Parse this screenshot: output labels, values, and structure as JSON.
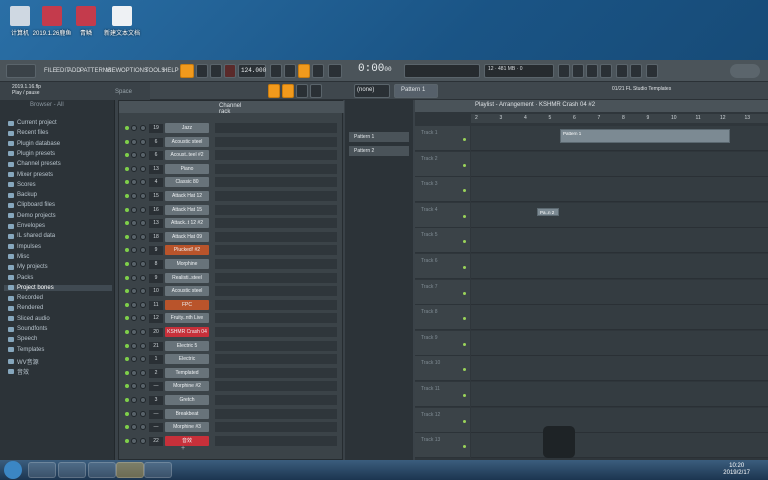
{
  "desktop": {
    "icons": [
      {
        "label": "计算机",
        "color": "#cfd8e2"
      },
      {
        "label": "2019.1.26鹿鱼",
        "color": "#c43b4c"
      },
      {
        "label": "青鳞",
        "color": "#c43b4c"
      },
      {
        "label": "新建文本文档",
        "color": "#eef1f4"
      }
    ]
  },
  "menu": {
    "items": [
      "FILE",
      "EDIT",
      "ADD",
      "PATTERNS",
      "VIEW",
      "OPTIONS",
      "TOOLS",
      "HELP"
    ]
  },
  "transport": {
    "tempo": "124.000",
    "time": "0:00",
    "time_small": "00",
    "pattern_label": "Pattern 1",
    "snap": "(none)",
    "cpu": "12",
    "mem": "481 MB",
    "voices": "0"
  },
  "hint": {
    "file": "2019.1.16.flp",
    "status": "Play / pause"
  },
  "row2": {
    "space_label": "Space",
    "all_label": "All",
    "channel_rack_label": "Channel rack",
    "project_info": "01/21 FL Studio Templates"
  },
  "browser": {
    "header": "Browser - All",
    "items": [
      "Current project",
      "Recent files",
      "Plugin database",
      "Plugin presets",
      "Channel presets",
      "Mixer presets",
      "Scores",
      "Backup",
      "Clipboard files",
      "Demo projects",
      "Envelopes",
      "IL shared data",
      "Impulses",
      "Misc",
      "My projects",
      "Packs",
      "Project bones",
      "Recorded",
      "Rendered",
      "Sliced audio",
      "Soundfonts",
      "Speech",
      "Templates",
      "WV音源",
      "音效"
    ],
    "selected_index": 16
  },
  "channels": [
    {
      "num": "19",
      "name": "Jazz",
      "style": "grey"
    },
    {
      "num": "6",
      "name": "Acoustic steel",
      "style": "grey"
    },
    {
      "num": "6",
      "name": "Acoust..teel #2",
      "style": "grey"
    },
    {
      "num": "13",
      "name": "Piano",
      "style": "grey"
    },
    {
      "num": "4",
      "name": "Classic 80",
      "style": "grey"
    },
    {
      "num": "15",
      "name": "Attack Hat 12",
      "style": "grey"
    },
    {
      "num": "16",
      "name": "Attack Hat 15",
      "style": "grey"
    },
    {
      "num": "13",
      "name": "Attack..t 12 #2",
      "style": "grey"
    },
    {
      "num": "18",
      "name": "Attack Hat 09",
      "style": "grey"
    },
    {
      "num": "9",
      "name": "Plucked! #2",
      "style": "orange"
    },
    {
      "num": "8",
      "name": "Morphine",
      "style": "grey"
    },
    {
      "num": "9",
      "name": "Realisti..steel",
      "style": "grey"
    },
    {
      "num": "10",
      "name": "Acoustic steel",
      "style": "grey"
    },
    {
      "num": "11",
      "name": "FPC",
      "style": "orange"
    },
    {
      "num": "12",
      "name": "Fruity..nth Live",
      "style": "grey"
    },
    {
      "num": "20",
      "name": "KSHMR Crash 04",
      "style": "red"
    },
    {
      "num": "21",
      "name": "Electric 5",
      "style": "grey"
    },
    {
      "num": "1",
      "name": "Electric",
      "style": "grey"
    },
    {
      "num": "2",
      "name": "Templated",
      "style": "grey"
    },
    {
      "num": "—",
      "name": "Morphine #2",
      "style": "grey"
    },
    {
      "num": "3",
      "name": "Gretch",
      "style": "grey"
    },
    {
      "num": "—",
      "name": "Breakbeat",
      "style": "grey"
    },
    {
      "num": "—",
      "name": "Morphine #3",
      "style": "grey"
    },
    {
      "num": "22",
      "name": "音效",
      "style": "red"
    }
  ],
  "patterns": [
    "Pattern 1",
    "Pattern 2"
  ],
  "playlist": {
    "title": "Playlist - Arrangement · KSHMR Crash 04 #2",
    "ruler": [
      "2",
      "3",
      "4",
      "5",
      "6",
      "7",
      "8",
      "9",
      "10",
      "11",
      "12",
      "13"
    ],
    "tracks": [
      "Track 1",
      "Track 2",
      "Track 3",
      "Track 4",
      "Track 5",
      "Track 6",
      "Track 7",
      "Track 8",
      "Track 9",
      "Track 10",
      "Track 11",
      "Track 12",
      "Track 13"
    ],
    "clips": {
      "pattern1": "Pattern 1",
      "ks": "Pa..n 2"
    }
  },
  "taskbar": {
    "time": "10:20",
    "date": "2019/2/17"
  }
}
